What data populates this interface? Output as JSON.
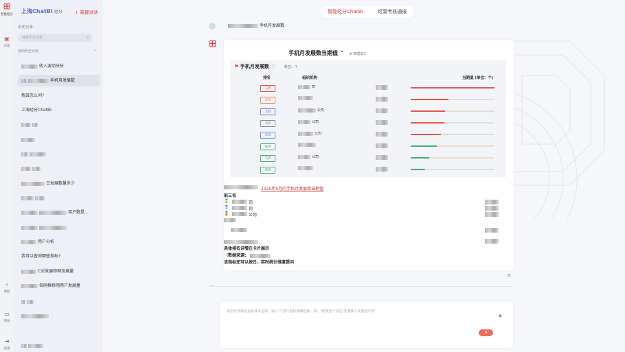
{
  "rail": {
    "logo_label": "智能经分",
    "nav": [
      {
        "label": "对话",
        "icon": "chat-icon"
      },
      {
        "label": "收起",
        "icon": "collapse-icon"
      },
      {
        "label": "布局",
        "icon": "layout-icon"
      },
      {
        "label": "退出",
        "icon": "logout-icon"
      }
    ]
  },
  "sidebar": {
    "app_title": "上海ChatBI",
    "app_subtitle": "经分",
    "new_chat": "+ 新建对话",
    "history_label": "历史记录",
    "search_placeholder": "搜索历史记录",
    "section_label": "近四历史对话",
    "items": [
      {
        "label": "收入波动分析"
      },
      {
        "label": "手机月发展数"
      },
      {
        "label": "我该怎么问?"
      },
      {
        "label": "上海经分ChatBI"
      },
      {
        "label": ""
      },
      {
        "label": ""
      },
      {
        "label": ""
      },
      {
        "label": ""
      },
      {
        "label": "日发展数量多少"
      },
      {
        "label": ""
      },
      {
        "label": "用户数是…"
      },
      {
        "label": ""
      },
      {
        "label": "用户分析"
      },
      {
        "label": "我可以查询哪些指标?"
      },
      {
        "label": "C对发展移网发展量"
      },
      {
        "label": "各网格移网用户发展量"
      },
      {
        "label": ""
      },
      {
        "label": ""
      },
      {
        "label": ""
      }
    ]
  },
  "main": {
    "tabs": [
      {
        "label": "智能经分ChatBI"
      },
      {
        "label": "经营考核通报"
      }
    ],
    "user_query": "手机月发展数",
    "card": {
      "title": "手机月发展数当期值",
      "aux": "数据来1",
      "panel_title": "手机月发展数",
      "unit": "单位：个",
      "columns": {
        "rank": "排名",
        "org": "组织机构",
        "value": "当期值 (单位：个)"
      },
      "rows": [
        {
          "rank": "1/8",
          "org": "司",
          "ratio": 1.0,
          "color": "#e0584b"
        },
        {
          "rank": "2/8",
          "org": "",
          "ratio": 0.45,
          "color": "#e0584b"
        },
        {
          "rank": "3/8",
          "org": "公司",
          "ratio": 0.41,
          "color": "#e0584b"
        },
        {
          "rank": "4/8",
          "org": "公司",
          "ratio": 0.4,
          "color": "#e0584b"
        },
        {
          "rank": "5/8",
          "org": "公司",
          "ratio": 0.36,
          "color": "#e0584b"
        },
        {
          "rank": "6/8",
          "org": "",
          "ratio": 0.31,
          "color": "#3fae7a"
        },
        {
          "rank": "7/8",
          "org": "公司",
          "ratio": 0.22,
          "color": "#3fae7a"
        },
        {
          "rank": "8/8",
          "org": "",
          "ratio": 0.17,
          "color": "#3fae7a"
        }
      ],
      "rank_colors": [
        "#d94c4c",
        "#e08a4c",
        "#7a6ad8",
        "#8a8a9a",
        "#5a8ae0",
        "#3fae7a",
        "#3fae7a",
        "#3fae7a"
      ]
    },
    "summary": {
      "link": "2025年5月的手机月发展数当期值",
      "top3": "前三名",
      "lines": [
        "司",
        "司",
        "公司"
      ],
      "detail": "具体排名详情在卡片展示",
      "source": "（数据来源：",
      "tip": "该指标还可以按日、实时统计维度提问"
    },
    "input_placeholder": "如您无法确定指标具体名称，输入\"/\"进行指标模糊检索，如：\"帮我查下东区/发展移入发展用户数\""
  }
}
